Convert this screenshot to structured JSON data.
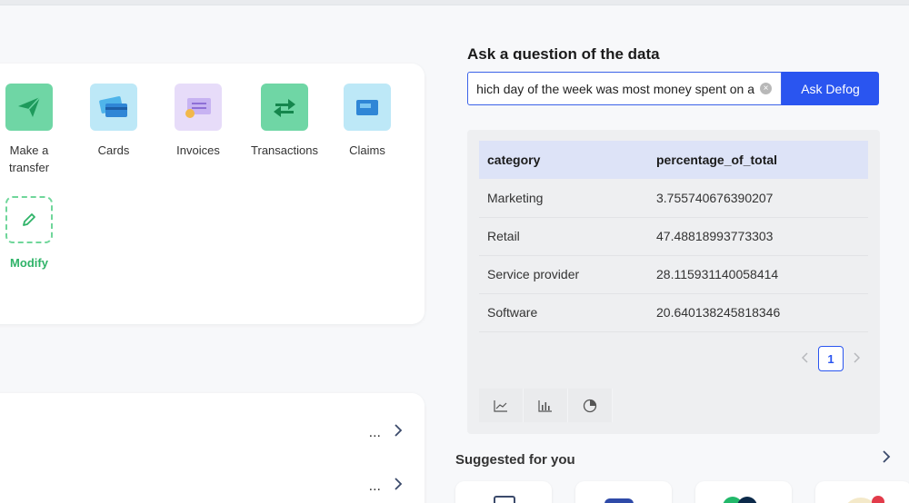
{
  "quick_actions": [
    {
      "label": "Make a transfer",
      "icon": "paper-plane-icon",
      "color": "#6fd6a5"
    },
    {
      "label": "Cards",
      "icon": "cards-icon",
      "color": "#bde8f7"
    },
    {
      "label": "Invoices",
      "icon": "invoice-icon",
      "color": "#e7dcf9"
    },
    {
      "label": "Transactions",
      "icon": "transfer-arrows-icon",
      "color": "#6fd6a5"
    },
    {
      "label": "Claims",
      "icon": "claims-card-icon",
      "color": "#bde8f7"
    }
  ],
  "modify": {
    "label": "Modify",
    "icon": "pencil-icon",
    "color": "#2fb368"
  },
  "list_rows": [
    {
      "text": "...",
      "icon": "chevron-right-icon"
    },
    {
      "text": "...",
      "icon": "chevron-right-icon"
    }
  ],
  "ask": {
    "heading": "Ask a question of the data",
    "query": "Which day of the week was most money spent on a",
    "button_label": "Ask Defog"
  },
  "results": {
    "columns": [
      "category",
      "percentage_of_total"
    ],
    "rows": [
      [
        "Marketing",
        "3.755740676390207"
      ],
      [
        "Retail",
        "47.48818993773303"
      ],
      [
        "Service provider",
        "28.115931140058414"
      ],
      [
        "Software",
        "20.640138245818346"
      ]
    ],
    "current_page": "1"
  },
  "chart_tabs": [
    "line-chart-icon",
    "bar-chart-icon",
    "pie-chart-icon"
  ],
  "suggested": {
    "title": "Suggested for you"
  },
  "colors": {
    "accent": "#2a55f0",
    "green": "#2fb368"
  }
}
